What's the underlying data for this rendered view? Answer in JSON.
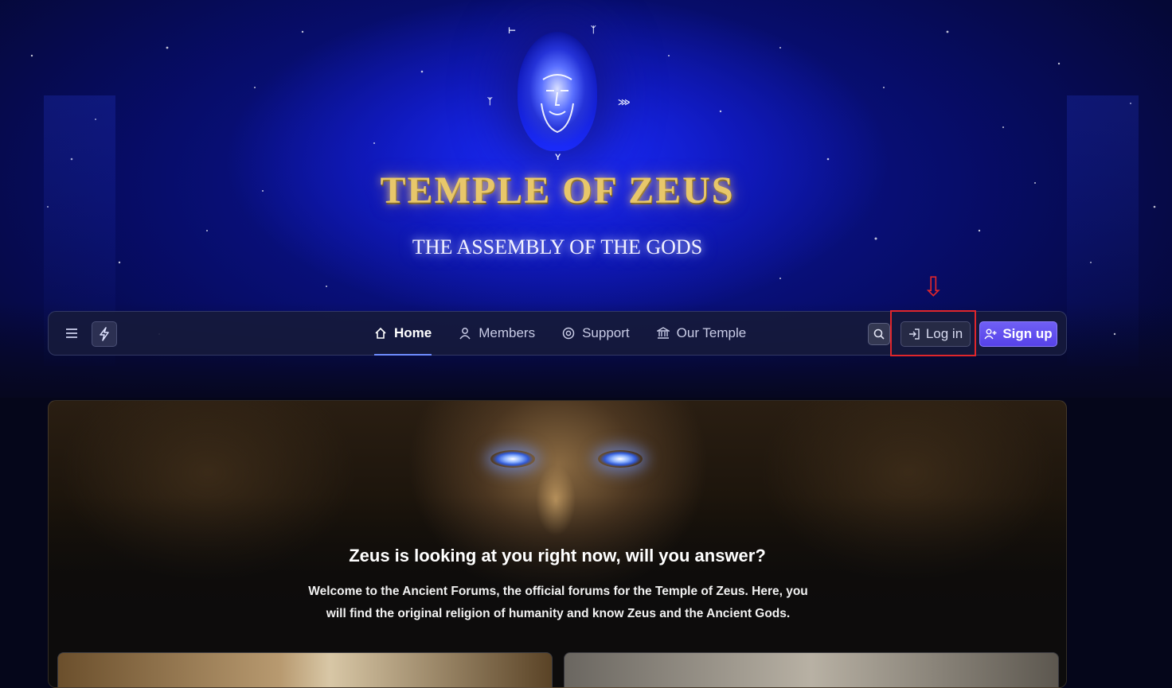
{
  "header": {
    "title": "TEMPLE OF ZEUS",
    "subtitle": "THE ASSEMBLY OF THE GODS"
  },
  "navbar": {
    "links": [
      {
        "label": "Home",
        "icon": "home-icon",
        "active": true
      },
      {
        "label": "Members",
        "icon": "user-icon",
        "active": false
      },
      {
        "label": "Support",
        "icon": "lifebuoy-icon",
        "active": false
      },
      {
        "label": "Our Temple",
        "icon": "temple-icon",
        "active": false
      }
    ],
    "login_label": "Log in",
    "signup_label": "Sign up"
  },
  "annotation": {
    "arrow": "⇩"
  },
  "hero": {
    "title": "Zeus is looking at you right now, will you answer?",
    "text": "Welcome to the Ancient Forums, the official forums for the Temple of Zeus. Here, you will find the original religion of humanity and know Zeus and the Ancient Gods."
  },
  "colors": {
    "accent": "#5f4ff0",
    "highlight": "#e0262b",
    "title_gold": "#e8c76a"
  }
}
